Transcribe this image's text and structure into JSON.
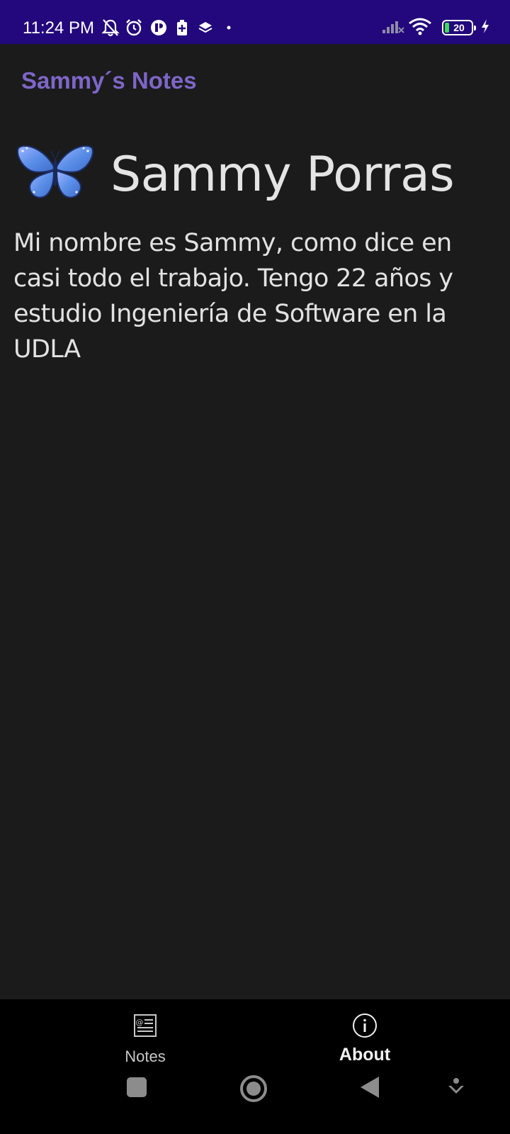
{
  "status_bar": {
    "time": "11:24 PM",
    "battery_level": "20",
    "icons_left": [
      "bell-off-icon",
      "alarm-icon",
      "app-circle-icon",
      "battery-saver-icon",
      "layers-icon",
      "dot-icon"
    ],
    "icons_right": [
      "cellular-signal-icon",
      "wifi-icon",
      "battery-icon",
      "charging-bolt-icon"
    ]
  },
  "app": {
    "title": "Sammy´s Notes"
  },
  "profile": {
    "avatar_icon": "butterfly-icon",
    "name": "Sammy Porras",
    "bio": "Mi nombre es Sammy, como dice en casi todo el trabajo. Tengo 22 años y estudio Ingeniería de Software en la UDLA"
  },
  "bottom_nav": {
    "items": [
      {
        "label": "Notes",
        "icon": "notes-icon",
        "active": false
      },
      {
        "label": "About",
        "icon": "info-icon",
        "active": true
      }
    ]
  },
  "system_nav": {
    "buttons": [
      "recents-square-icon",
      "home-circle-icon",
      "back-triangle-icon",
      "hide-keyboard-icon"
    ]
  },
  "colors": {
    "status_bar": "#22087c",
    "background": "#1b1b1c",
    "accent": "#7e66c8",
    "bottom_nav": "#000000",
    "text": "#e2e2e2"
  }
}
